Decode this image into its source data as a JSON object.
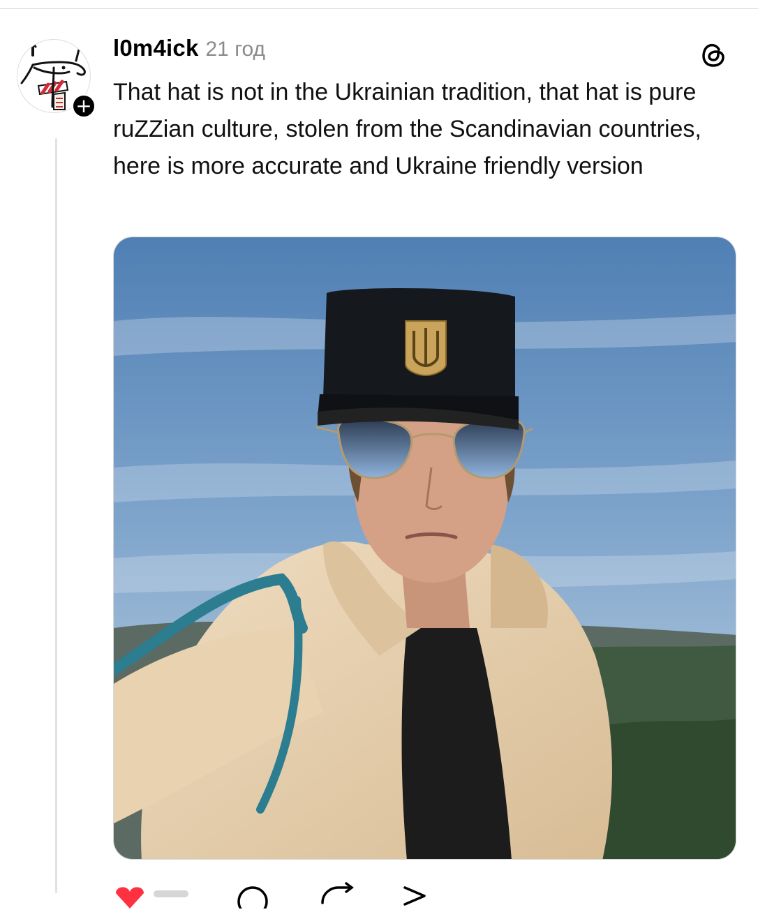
{
  "post": {
    "username": "l0m4ick",
    "timestamp": "21 год",
    "text": "That hat is not in the Ukrainian tradition, that hat is pure ruZZian culture, stolen from the Scandinavian countries, here is more accurate and Ukraine friendly version",
    "follow_symbol": "+",
    "app_icon": "threads-icon",
    "media": {
      "icon": "photo",
      "subject": "selfie of a man in a black cap with a trident badge, aviator sunglasses and a fur coat"
    },
    "actions": [
      "like-icon",
      "comment-icon",
      "repost-icon",
      "share-icon"
    ]
  },
  "colors": {
    "text": "#101010",
    "muted": "#8a8a8a",
    "like": "#ff3040",
    "sky_top": "#4f7fb4",
    "sky_bottom": "#c9d8e6"
  }
}
